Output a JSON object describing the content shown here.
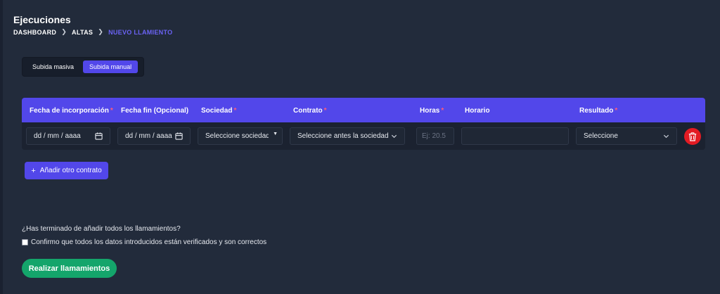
{
  "header": {
    "title": "Ejecuciones",
    "breadcrumb": [
      "DASHBOARD",
      "ALTAS",
      "NUEVO LLAMIENTO"
    ],
    "breadcrumb_active_color": "#6b63f5"
  },
  "upload_toggle": {
    "options": [
      "Subida masiva",
      "Subida manual"
    ],
    "selected": "Subida manual"
  },
  "table": {
    "header_color": "#5247ea",
    "columns": [
      {
        "label": "Fecha de incorporación",
        "required": true
      },
      {
        "label": "Fecha fin (Opcional)",
        "required": false
      },
      {
        "label": "Sociedad",
        "required": true
      },
      {
        "label": "Contrato",
        "required": true
      },
      {
        "label": "Horas",
        "required": true
      },
      {
        "label": "Horario",
        "required": false
      },
      {
        "label": "Resultado",
        "required": true
      }
    ],
    "required_marker": "*",
    "row": {
      "fecha_incorporacion": "dd / mm / aaaa",
      "fecha_fin": "dd / mm / aaaa",
      "sociedad": "Seleccione sociedad",
      "contrato": "Seleccione antes la sociedad",
      "horas_placeholder": "Ej: 20.5",
      "horario": "",
      "resultado": "Seleccione"
    },
    "delete_icon": "trash-icon",
    "delete_color": "#e31b23"
  },
  "add_contract_button": {
    "icon": "plus-icon",
    "label": "Añadir otro contrato"
  },
  "confirmation": {
    "question": "¿Has terminado de añadir todos los llamamientos?",
    "checkbox_label": "Confirmo que todos los datos introducidos están verificados y son correctos",
    "checked": false
  },
  "submit_button": {
    "label": "Realizar llamamientos",
    "color": "#14a56b"
  }
}
